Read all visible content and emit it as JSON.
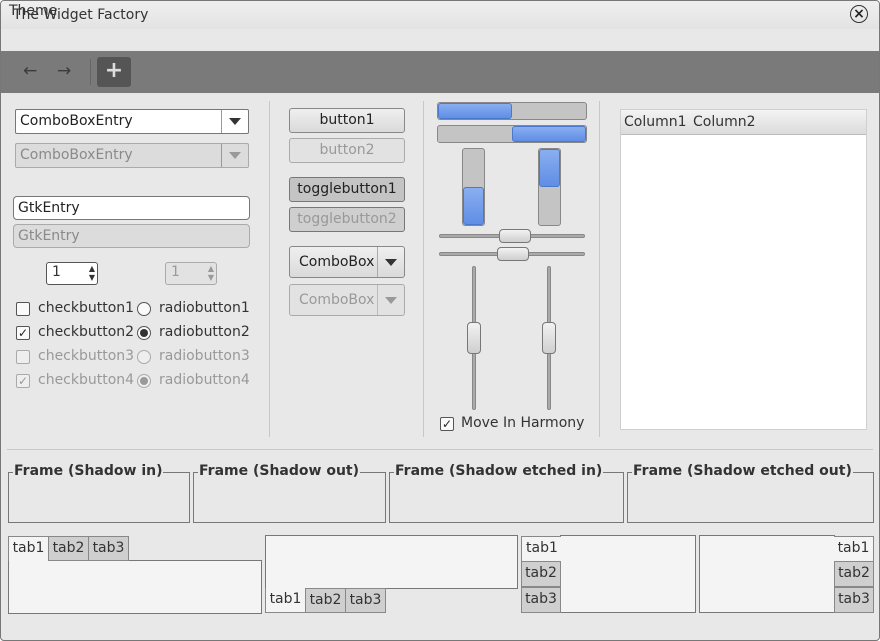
{
  "window": {
    "title": "The Widget Factory"
  },
  "menubar": {
    "items": [
      "Theme"
    ]
  },
  "toolbar": {
    "back_icon": "←",
    "forward_icon": "→",
    "add_icon": "+"
  },
  "left": {
    "combo_entry": "ComboBoxEntry",
    "combo_entry_disabled": "ComboBoxEntry",
    "entry": "GtkEntry",
    "entry_disabled": "GtkEntry",
    "spin": "1",
    "spin_disabled": "1",
    "checks": [
      {
        "label": "checkbutton1",
        "checked": false,
        "disabled": false
      },
      {
        "label": "checkbutton2",
        "checked": true,
        "disabled": false
      },
      {
        "label": "checkbutton3",
        "checked": false,
        "disabled": true
      },
      {
        "label": "checkbutton4",
        "checked": true,
        "disabled": true
      }
    ],
    "radios": [
      {
        "label": "radiobutton1",
        "checked": false,
        "disabled": false
      },
      {
        "label": "radiobutton2",
        "checked": true,
        "disabled": false
      },
      {
        "label": "radiobutton3",
        "checked": false,
        "disabled": true
      },
      {
        "label": "radiobutton4",
        "checked": true,
        "disabled": true
      }
    ]
  },
  "middle": {
    "button1": "button1",
    "button2": "button2",
    "toggle1": "togglebutton1",
    "toggle2": "togglebutton2",
    "combo1": "ComboBox",
    "combo2": "ComboBox"
  },
  "ranges": {
    "progress_h1": 0.5,
    "progress_h2": 0.5,
    "progress_v1": 0.5,
    "progress_v2": 0.5,
    "move_in_harmony": "Move In Harmony"
  },
  "tree": {
    "columns": [
      "Column1",
      "Column2"
    ]
  },
  "frames": [
    "Frame (Shadow in)",
    "Frame (Shadow out)",
    "Frame (Shadow etched in)",
    "Frame (Shadow etched out)"
  ],
  "notebooks": {
    "tabs": [
      "tab1",
      "tab2",
      "tab3"
    ]
  }
}
